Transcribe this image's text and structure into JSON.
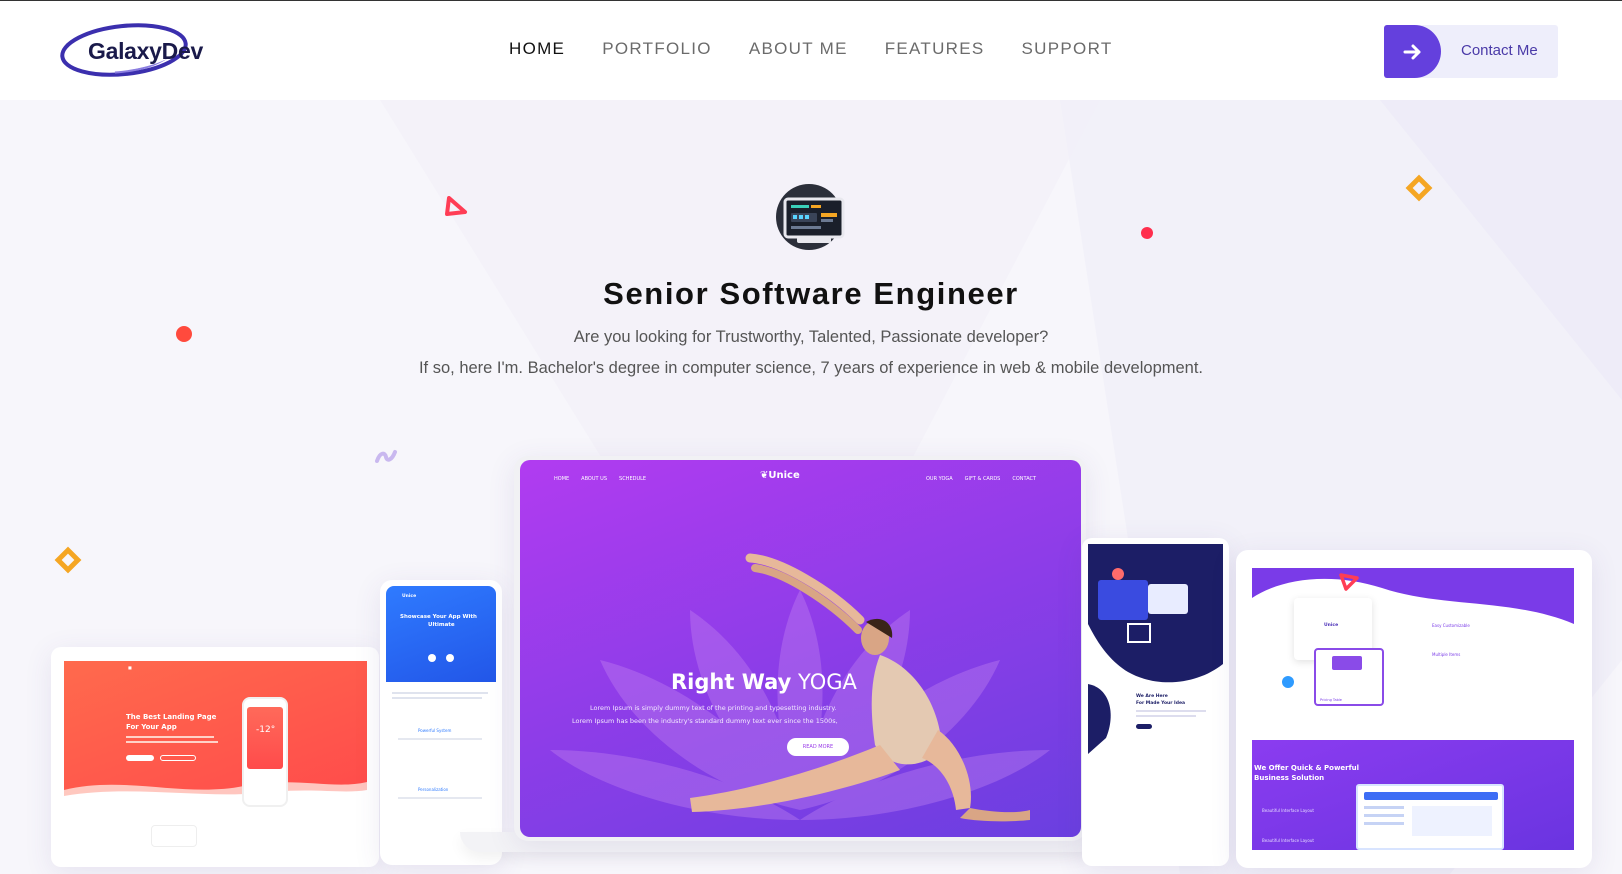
{
  "brand": {
    "name": "GalaxyDev"
  },
  "nav": {
    "items": [
      {
        "label": "HOME",
        "active": true
      },
      {
        "label": "PORTFOLIO",
        "active": false
      },
      {
        "label": "ABOUT ME",
        "active": false
      },
      {
        "label": "FEATURES",
        "active": false
      },
      {
        "label": "SUPPORT",
        "active": false
      }
    ]
  },
  "contact": {
    "label": "Contact Me",
    "icon": "arrow-right-icon"
  },
  "hero": {
    "title": "Senior Software Engineer",
    "line1": "Are you looking for Trustworthy, Talented, Passionate developer?",
    "line2": "If so, here I'm. Bachelor's degree in computer science, 7 years of experience in web & mobile development.",
    "icon": "computer-screen-icon"
  },
  "showcase": {
    "laptop": {
      "nav_left": [
        "HOME",
        "ABOUT US",
        "SCHEDULE"
      ],
      "brand": "Unice",
      "nav_right": [
        "OUR YOGA",
        "GIFT & CARDS",
        "CONTACT"
      ],
      "headline_bold": "Right Way",
      "headline_light": "YOGA",
      "body1": "Lorem Ipsum is simply dummy text of the printing and typesetting industry.",
      "body2": "Lorem Ipsum has been the industry's standard dummy text ever since the 1500s,",
      "button": "READ MORE"
    },
    "tablet_left": {
      "title1": "The Best Landing Page",
      "title2": "For Your App",
      "temp": "-12°"
    },
    "phone": {
      "brand": "Unice",
      "title1": "Showcase Your App With",
      "title2": "Ultimate",
      "feature1": "Powerful System",
      "feature2": "Personalization"
    },
    "tablet_mid": {
      "title1": "We Are Here",
      "title2": "For Made Your Idea"
    },
    "tablet_right": {
      "brand": "Unice",
      "feature1": "Easy Customizable",
      "feature2": "Multiple Items",
      "pricing": "Pricing Table",
      "banner1": "We Offer Quick & Powerful",
      "banner2": "Business Solution",
      "bullet1": "Beautiful Interface Layout",
      "bullet2": "Beautiful Interface Layout"
    }
  },
  "colors": {
    "accent": "#6440dd",
    "brand_dark": "#1a1a4a",
    "orange": "#f5a623",
    "red": "#ff4d4f"
  }
}
